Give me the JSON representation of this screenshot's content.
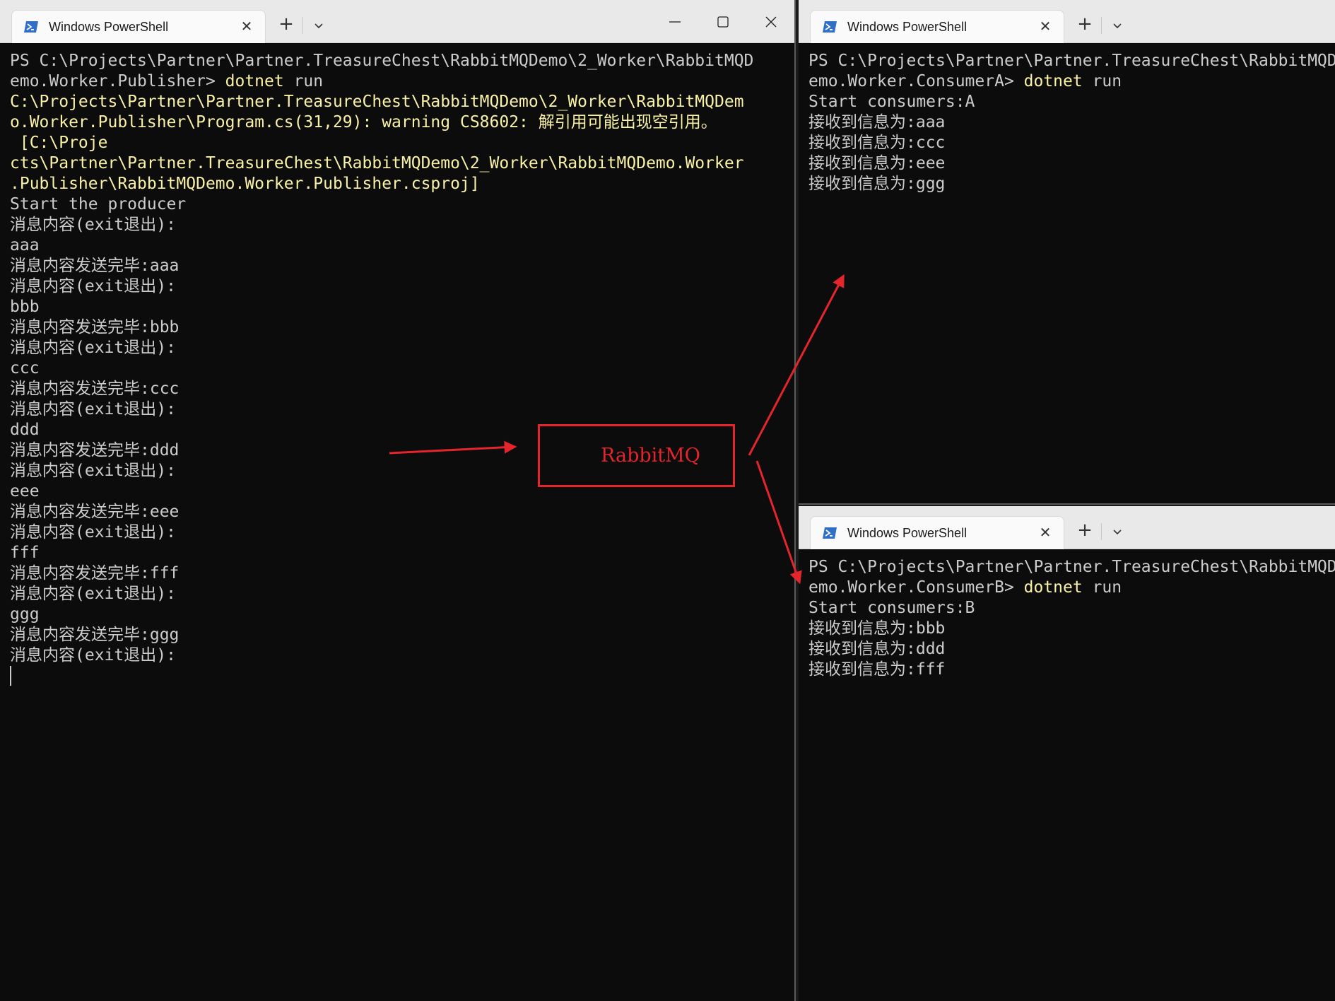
{
  "publisher": {
    "tab_title": "Windows PowerShell",
    "lines": [
      [
        {
          "t": "PS C:\\Projects\\Partner\\Partner.TreasureChest\\RabbitMQDemo\\2_Worker\\RabbitMQD"
        }
      ],
      [
        {
          "t": "emo.Worker.Publisher> "
        },
        {
          "t": "dotnet",
          "c": "hl"
        },
        {
          "t": " run"
        }
      ],
      [
        {
          "t": "C:\\Projects\\Partner\\Partner.TreasureChest\\RabbitMQDemo\\2_Worker\\RabbitMQDem",
          "c": "warn"
        }
      ],
      [
        {
          "t": "o.Worker.Publisher\\Program.cs(31,29): warning CS8602: 解引用可能出现空引用。",
          "c": "warn"
        }
      ],
      [
        {
          "t": " [C:\\Proje",
          "c": "warn"
        }
      ],
      [
        {
          "t": "cts\\Partner\\Partner.TreasureChest\\RabbitMQDemo\\2_Worker\\RabbitMQDemo.Worker",
          "c": "warn"
        }
      ],
      [
        {
          "t": ".Publisher\\RabbitMQDemo.Worker.Publisher.csproj]",
          "c": "warn"
        }
      ],
      [
        {
          "t": "Start the producer"
        }
      ],
      [
        {
          "t": "消息内容(exit退出):"
        }
      ],
      [
        {
          "t": "aaa"
        }
      ],
      [
        {
          "t": "消息内容发送完毕:aaa"
        }
      ],
      [
        {
          "t": "消息内容(exit退出):"
        }
      ],
      [
        {
          "t": "bbb"
        }
      ],
      [
        {
          "t": "消息内容发送完毕:bbb"
        }
      ],
      [
        {
          "t": "消息内容(exit退出):"
        }
      ],
      [
        {
          "t": "ccc"
        }
      ],
      [
        {
          "t": "消息内容发送完毕:ccc"
        }
      ],
      [
        {
          "t": "消息内容(exit退出):"
        }
      ],
      [
        {
          "t": "ddd"
        }
      ],
      [
        {
          "t": "消息内容发送完毕:ddd"
        }
      ],
      [
        {
          "t": "消息内容(exit退出):"
        }
      ],
      [
        {
          "t": "eee"
        }
      ],
      [
        {
          "t": "消息内容发送完毕:eee"
        }
      ],
      [
        {
          "t": "消息内容(exit退出):"
        }
      ],
      [
        {
          "t": "fff"
        }
      ],
      [
        {
          "t": "消息内容发送完毕:fff"
        }
      ],
      [
        {
          "t": "消息内容(exit退出):"
        }
      ],
      [
        {
          "t": "ggg"
        }
      ],
      [
        {
          "t": "消息内容发送完毕:ggg"
        }
      ],
      [
        {
          "t": "消息内容(exit退出):"
        }
      ]
    ]
  },
  "consumer_a": {
    "tab_title": "Windows PowerShell",
    "lines": [
      [
        {
          "t": "PS C:\\Projects\\Partner\\Partner.TreasureChest\\RabbitMQDemo\\2_Worker\\RabbitMQD"
        }
      ],
      [
        {
          "t": "emo.Worker.ConsumerA> "
        },
        {
          "t": "dotnet",
          "c": "hl"
        },
        {
          "t": " run"
        }
      ],
      [
        {
          "t": "Start consumers:A"
        }
      ],
      [
        {
          "t": "接收到信息为:aaa"
        }
      ],
      [
        {
          "t": "接收到信息为:ccc"
        }
      ],
      [
        {
          "t": "接收到信息为:eee"
        }
      ],
      [
        {
          "t": "接收到信息为:ggg"
        }
      ]
    ]
  },
  "consumer_b": {
    "tab_title": "Windows PowerShell",
    "lines": [
      [
        {
          "t": "PS C:\\Projects\\Partner\\Partner.TreasureChest\\RabbitMQDemo\\2_Worker\\RabbitMQD"
        }
      ],
      [
        {
          "t": "emo.Worker.ConsumerB> "
        },
        {
          "t": "dotnet",
          "c": "hl"
        },
        {
          "t": " run"
        }
      ],
      [
        {
          "t": "Start consumers:B"
        }
      ],
      [
        {
          "t": "接收到信息为:bbb"
        }
      ],
      [
        {
          "t": "接收到信息为:ddd"
        }
      ],
      [
        {
          "t": "接收到信息为:fff"
        }
      ]
    ]
  },
  "annotation": {
    "label": "RabbitMQ",
    "color": "#e4252b"
  },
  "icons": {
    "tab_icon": "powershell-icon",
    "tab_close": "close-icon",
    "new_tab": "plus-icon",
    "tab_menu": "chevron-down-icon",
    "minimize": "minimize-icon",
    "maximize": "maximize-icon",
    "close": "close-icon"
  },
  "glyphs": {
    "close": "✕",
    "plus": "+"
  }
}
